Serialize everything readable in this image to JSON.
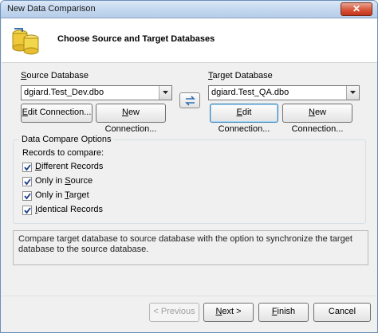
{
  "window": {
    "title": "New Data Comparison",
    "close_glyph": "✕"
  },
  "header": {
    "title": "Choose Source and Target Databases",
    "icon": "database-compare-icon"
  },
  "source": {
    "label_prefix": "S",
    "label_rest": "ource Database",
    "selected": "dgiard.Test_Dev.dbo",
    "edit_prefix": "E",
    "edit_rest": "dit Connection...",
    "new_prefix": "N",
    "new_rest": "ew Connection..."
  },
  "target": {
    "label_prefix": "T",
    "label_rest": "arget Database",
    "selected": "dgiard.Test_QA.dbo",
    "edit_prefix": "E",
    "edit_rest": "dit Connection...",
    "new_prefix": "",
    "new_mid": "N",
    "new_rest": "ew Connection..."
  },
  "options": {
    "group_title": "Data Compare Options",
    "records_label": "Records to compare:",
    "items": [
      {
        "pre": "",
        "key": "D",
        "post": "ifferent Records",
        "checked": true
      },
      {
        "pre": "Only in ",
        "key": "S",
        "post": "ource",
        "checked": true
      },
      {
        "pre": "Only in ",
        "key": "T",
        "post": "arget",
        "checked": true
      },
      {
        "pre": "",
        "key": "I",
        "post": "dentical Records",
        "checked": true
      }
    ]
  },
  "description": "Compare target database to source database with the option to synchronize the target database to the source database.",
  "footer": {
    "previous": "< Previous",
    "next_key": "N",
    "next_rest": "ext >",
    "finish_key": "F",
    "finish_rest": "inish",
    "cancel": "Cancel"
  }
}
